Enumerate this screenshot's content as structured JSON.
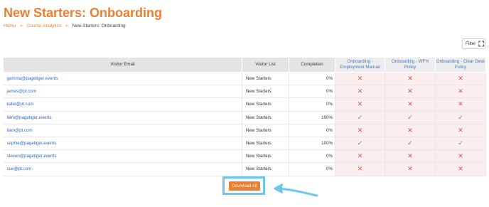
{
  "page": {
    "title": "New Starters: Onboarding",
    "accent_color": "#ef7d30"
  },
  "breadcrumb": {
    "home": "Home",
    "course_analytics": "Course Analytics",
    "current": "New Starters: Onboarding",
    "separator": "»"
  },
  "filter": {
    "label": "Filter",
    "icon": "expand-icon"
  },
  "table": {
    "headers": {
      "email": "Visitor Email",
      "list": "Visitor List",
      "completion": "Completion",
      "course1": "Onboarding - Employment Manual",
      "course2": "Onboarding - WFH Policy",
      "course3": "Onboarding - Clear Desk Policy"
    },
    "rows": [
      {
        "email": "gemma@pagetiger.events",
        "list": "New Starters",
        "completion": "0%",
        "c1": "✕",
        "c2": "✕",
        "c3": "✕"
      },
      {
        "email": "james@pt.com",
        "list": "New Starters",
        "completion": "0%",
        "c1": "✕",
        "c2": "✕",
        "c3": "✕"
      },
      {
        "email": "katie@pt.com",
        "list": "New Starters",
        "completion": "0%",
        "c1": "✕",
        "c2": "✕",
        "c3": "✕"
      },
      {
        "email": "liam@pagetiger.events",
        "list": "New Starters",
        "completion": "100%",
        "c1": "✓",
        "c2": "✓",
        "c3": "✓"
      },
      {
        "email": "liam@pt.com",
        "list": "New Starters",
        "completion": "0%",
        "c1": "✕",
        "c2": "✕",
        "c3": "✕"
      },
      {
        "email": "sophie@pagetiger.events",
        "list": "New Starters",
        "completion": "100%",
        "c1": "✓",
        "c2": "✓",
        "c3": "✓"
      },
      {
        "email": "steven@pagetiger.events",
        "list": "New Starters",
        "completion": "0%",
        "c1": "✕",
        "c2": "✕",
        "c3": "✕"
      },
      {
        "email": "sue@pt.com",
        "list": "New Starters",
        "completion": "0%",
        "c1": "✕",
        "c2": "✕",
        "c3": "✕"
      }
    ]
  },
  "download": {
    "label": "Download All"
  },
  "annotation": {
    "highlight_color": "#6cc6ee"
  }
}
